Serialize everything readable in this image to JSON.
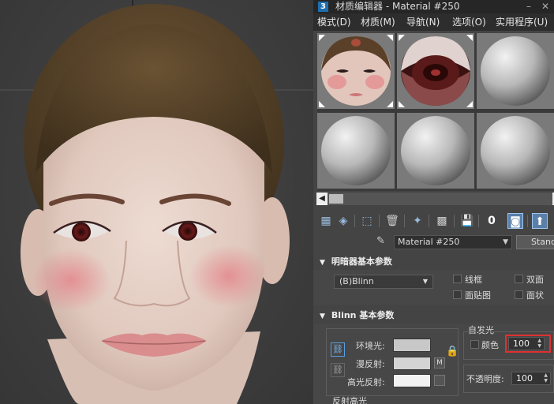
{
  "window": {
    "app_icon": "3",
    "title": "材质编辑器 - Material #250",
    "close_glyph": "✕"
  },
  "menu": [
    "模式(D)",
    "材质(M)",
    "导航(N)",
    "选项(O)",
    "实用程序(U)"
  ],
  "scroll": {
    "left_arrow": "◀",
    "right_arrow": "▶"
  },
  "material": {
    "name": "Material #250",
    "type": "Standard"
  },
  "shader_rollout": {
    "title": "明暗器基本参数",
    "shader_type": "(B)Blinn",
    "options": {
      "wire": "线框",
      "two_sided": "双面",
      "face_map": "面贴图",
      "faceted": "面状"
    }
  },
  "blinn_rollout": {
    "title": "Blinn 基本参数",
    "ambient_label": "环境光:",
    "diffuse_label": "漫反射:",
    "specular_label": "高光反射:",
    "map_button": "M",
    "self_illum_title": "自发光",
    "color_label": "颜色",
    "self_illum_value": "100",
    "opacity_label": "不透明度:",
    "opacity_value": "100",
    "specular_section": "反射高光"
  },
  "colors": {
    "ambient": "#c8c8c8",
    "diffuse": "#d4d4d4",
    "specular": "#f2f2f2",
    "highlight_box": "#e03030"
  }
}
